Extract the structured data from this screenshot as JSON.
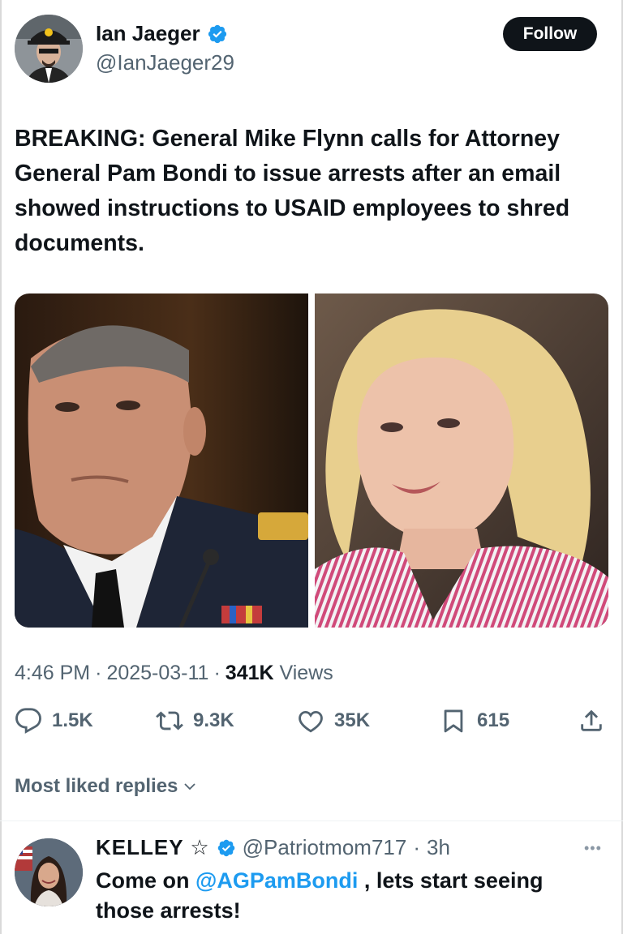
{
  "author": {
    "name": "Ian Jaeger",
    "handle": "@IanJaeger29",
    "verified": true,
    "follow_label": "Follow"
  },
  "tweet": {
    "text": "BREAKING: General Mike Flynn calls for Attorney General Pam Bondi to issue arrests after an email showed instructions to USAID employees to shred documents.",
    "images": [
      "photo of Mike Flynn in uniform",
      "photo of Pam Bondi"
    ],
    "time": "4:46 PM",
    "date": "2025-03-11",
    "views_count": "341K",
    "views_label": "Views"
  },
  "stats": {
    "replies": "1.5K",
    "reposts": "9.3K",
    "likes": "35K",
    "bookmarks": "615"
  },
  "icons": {
    "reply": "reply-icon",
    "repost": "repost-icon",
    "like": "heart-icon",
    "bookmark": "bookmark-icon",
    "share": "share-icon",
    "verified": "verified-badge-icon"
  },
  "replies_section": {
    "sort_label": "Most liked replies"
  },
  "reply": {
    "name": "KELLEY ☆",
    "handle": "@Patriotmom717",
    "time": "3h",
    "more": "•••",
    "text_before": "Come on ",
    "mention": "@AGPamBondi",
    "text_after": " , lets start seeing those arrests!"
  },
  "colors": {
    "text": "#0f1419",
    "secondary": "#536471",
    "accent": "#1d9bf0",
    "follow_bg": "#0f1419"
  }
}
